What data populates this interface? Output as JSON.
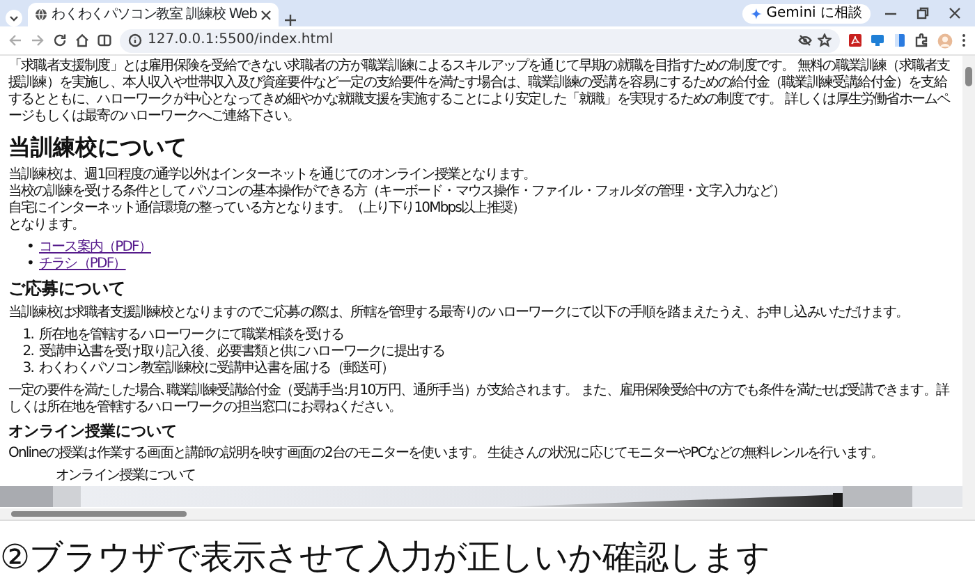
{
  "browser": {
    "tab": {
      "title": "わくわくパソコン教室 訓練校 Web",
      "selected": true
    },
    "address": "127.0.0.1:5500/index.html",
    "gemini_button": "Gemini に相談"
  },
  "page": {
    "blocks": [
      {
        "kind": "paragraph",
        "lines": [
          "「求職者支援制度」とは雇用保険を受給できない求職者の方が職業訓練によるスキルアップを通じて早期の就職を目指すための制度です。 無料の職業訓練（求職者支援訓練）を実施し、本人収入や世帯収入及び資産要件など一定の支給要件を満たす場合は、職業訓練の受講を容易にするための給付金（職業訓練受講給付金）を支給するとともに、ハローワークが中心となってきめ細やかな就職支援を実施することにより安定した「就職」を実現するための制度です。 詳しくは厚生労働省ホームページもしくは最寄のハローワークへご連絡下さい。"
        ]
      },
      {
        "kind": "h2",
        "text": "当訓練校について"
      },
      {
        "kind": "paragraph",
        "lines": [
          "当訓練校は、週1回程度の通学以外はインターネットを通じてのオンライン授業となります。",
          "当校の訓練を受ける条件として パソコンの基本操作ができる方（キーボード・マウス操作・ファイル・フォルダの管理・文字入力など）",
          "自宅にインターネット通信環境の整っている方となります。（上り下り10Mbps以上推奨）",
          "となります。"
        ]
      },
      {
        "kind": "links",
        "items": [
          {
            "marker": "•",
            "text": "コース案内（PDF）"
          },
          {
            "marker": "•",
            "text": "チラシ（PDF）"
          }
        ]
      },
      {
        "kind": "h3",
        "text": "ご応募について"
      },
      {
        "kind": "paragraph",
        "lines": [
          "当訓練校は求職者支援訓練校となりますのでご応募の際は、所轄を管理する最寄りのハローワークにて以下の手順を踏まえたうえ、お申し込みいただけます。"
        ]
      },
      {
        "kind": "steps",
        "items": [
          {
            "marker": "1.",
            "text": "所在地を管轄するハローワークにて職業相談を受ける"
          },
          {
            "marker": "2.",
            "text": "受講申込書を受け取り記入後、必要書類と供にハローワークに提出する"
          },
          {
            "marker": "3.",
            "text": "わくわくパソコン教室訓練校に受講申込書を届ける（郵送可）"
          }
        ]
      },
      {
        "kind": "paragraph",
        "lines": [
          "一定の要件を満たした場合､職業訓練受講給付金（受講手当:月10万円、通所手当）が支給されます。 また、雇用保険受給中の方でも条件を満たせば受講できます。詳しくは所在地を管轄するハローワークの担当窓口にお尋ねください。"
        ]
      },
      {
        "kind": "h4",
        "text": "オンライン授業について"
      },
      {
        "kind": "paragraph",
        "lines": [
          "Onlineの授業は作業する画面と講師の説明を映す画面の2台のモニターを使います。 生徒さんの状況に応じてモニターやPCなどの無料レンルを行います。"
        ]
      },
      {
        "kind": "figure",
        "caption": "オンライン授業について"
      }
    ]
  },
  "caption": "②ブラウザで表示させて入力が正しいか確認します"
}
